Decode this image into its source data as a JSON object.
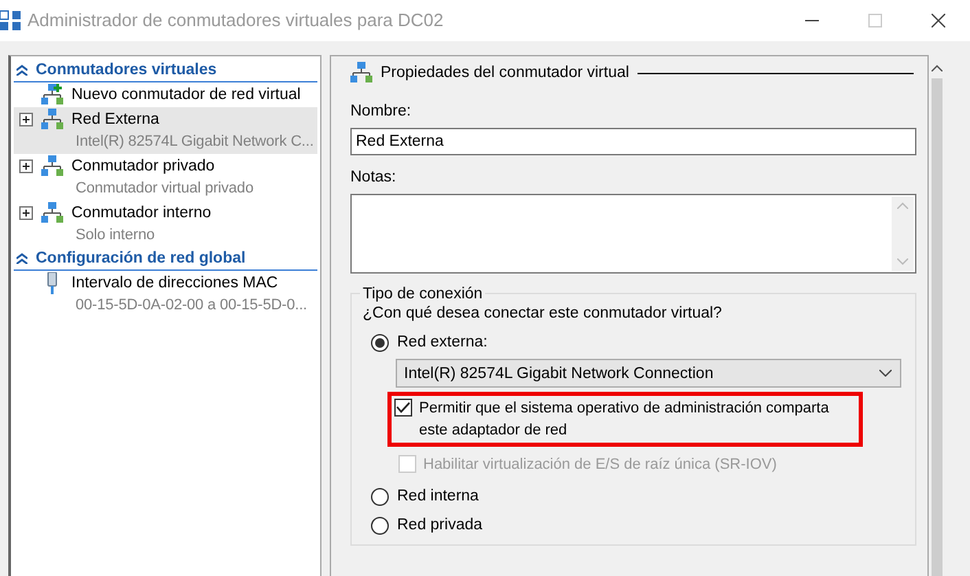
{
  "window": {
    "title": "Administrador de conmutadores virtuales para DC02",
    "maximize_disabled": true
  },
  "sidebar": {
    "sections": [
      {
        "title": "Conmutadores virtuales",
        "expanded": true,
        "items": [
          {
            "kind": "action",
            "label": "Nuevo conmutador de red virtual",
            "selected": false
          },
          {
            "kind": "switch",
            "label": "Red Externa",
            "sublabel": "Intel(R) 82574L Gigabit Network C...",
            "selected": true
          },
          {
            "kind": "switch",
            "label": "Conmutador privado",
            "sublabel": "Conmutador virtual privado",
            "selected": false
          },
          {
            "kind": "switch",
            "label": "Conmutador interno",
            "sublabel": "Solo interno",
            "selected": false
          }
        ]
      },
      {
        "title": "Configuración de red global",
        "expanded": true,
        "items": [
          {
            "kind": "mac",
            "label": "Intervalo de direcciones MAC",
            "sublabel": "00-15-5D-0A-02-00 a 00-15-5D-0...",
            "selected": false
          }
        ]
      }
    ]
  },
  "properties": {
    "header": "Propiedades del conmutador virtual",
    "name_label": "Nombre:",
    "name_value": "Red Externa",
    "notes_label": "Notas:",
    "connection": {
      "legend": "Tipo de conexión",
      "question": "¿Con qué desea conectar este conmutador virtual?",
      "options": [
        {
          "kind": "radio",
          "label": "Red externa:",
          "selected": true
        },
        {
          "kind": "select",
          "value": "Intel(R) 82574L Gigabit Network Connection"
        },
        {
          "kind": "checkbox",
          "label": "Permitir que el sistema operativo de administración comparta este adaptador de red",
          "checked": true,
          "disabled": false,
          "highlighted": true
        },
        {
          "kind": "checkbox",
          "label": "Habilitar virtualización de E/S de raíz única (SR-IOV)",
          "checked": false,
          "disabled": true,
          "highlighted": false
        },
        {
          "kind": "radio",
          "label": "Red interna",
          "selected": false
        },
        {
          "kind": "radio",
          "label": "Red privada",
          "selected": false
        }
      ]
    }
  }
}
